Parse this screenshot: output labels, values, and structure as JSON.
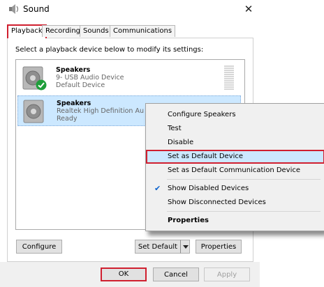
{
  "window": {
    "title": "Sound",
    "close_glyph": "✕"
  },
  "tabs": [
    {
      "label": "Playback",
      "active": true
    },
    {
      "label": "Recording"
    },
    {
      "label": "Sounds"
    },
    {
      "label": "Communications"
    }
  ],
  "instruction": "Select a playback device below to modify its settings:",
  "devices": [
    {
      "name": "Speakers",
      "line2": "9- USB Audio Device",
      "line3": "Default Device",
      "badge": "green-check-icon",
      "selected": false
    },
    {
      "name": "Speakers",
      "line2": "Realtek High Definition Au",
      "line3": "Ready",
      "selected": true
    }
  ],
  "buttons": {
    "configure": "Configure",
    "set_default": "Set Default",
    "properties": "Properties",
    "ok": "OK",
    "cancel": "Cancel",
    "apply": "Apply"
  },
  "context_menu": [
    {
      "label": "Configure Speakers"
    },
    {
      "label": "Test"
    },
    {
      "label": "Disable"
    },
    {
      "label": "Set as Default Device",
      "highlighted": true
    },
    {
      "label": "Set as Default Communication Device"
    },
    {
      "label": "Show Disabled Devices",
      "checked": true
    },
    {
      "label": "Show Disconnected Devices"
    },
    {
      "label": "Properties",
      "bold": true
    }
  ],
  "colors": {
    "highlight": "#cce8ff",
    "annotation_red": "#d01f2f",
    "check_green": "#1e9e3a"
  }
}
